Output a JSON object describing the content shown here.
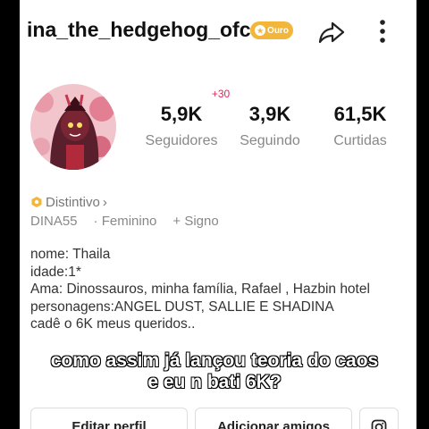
{
  "header": {
    "username": "ina_the_hedgehog_ofc",
    "badge_label": "Ouro",
    "share_icon": "share-arrow-icon",
    "more_icon": "vertical-dots-icon"
  },
  "stats": {
    "delta": "+30",
    "items": [
      {
        "value": "5,9K",
        "label": "Seguidores"
      },
      {
        "value": "3,9K",
        "label": "Seguindo"
      },
      {
        "value": "61,5K",
        "label": "Curtidas"
      }
    ]
  },
  "profile": {
    "distintivo": "Distintivo",
    "chevron": "›",
    "meta": [
      "DINA55",
      "· Feminino",
      "+ Signo"
    ]
  },
  "bio": [
    "nome: Thaila",
    "idade:1*",
    "Ama: Dinossauros, minha família, Rafael , Hazbin hotel",
    "personagens:ANGEL DUST, SALLIE E SHADINA",
    "cadê o 6K meus queridos.."
  ],
  "subtitle": {
    "line1": "como assim já lançou teoria do caos",
    "line2": "e eu n bati 6K?"
  },
  "buttons": {
    "edit": "Editar perfil",
    "add": "Adicionar amigos"
  },
  "colors": {
    "accent_red": "#ee1d52",
    "badge_gold": "#f2b63a"
  }
}
